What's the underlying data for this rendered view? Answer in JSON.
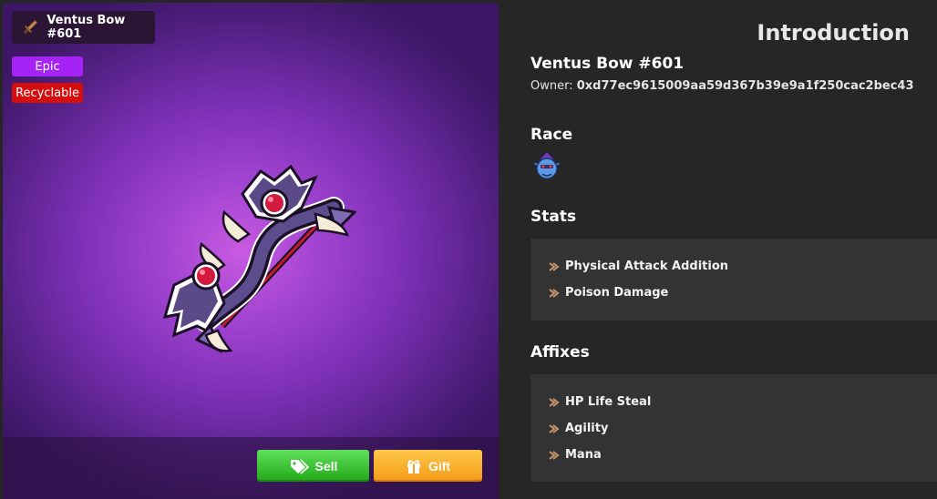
{
  "item": {
    "title": "Ventus Bow #601",
    "badges": {
      "rarity": "Epic",
      "recyclable": "Recyclable"
    }
  },
  "actions": {
    "sell_label": "Sell",
    "gift_label": "Gift"
  },
  "intro": {
    "heading": "Introduction",
    "name": "Ventus Bow #601",
    "owner_label": "Owner:",
    "owner_address": "0xd77ec9615009aa59d367b39e9a1f250cac2bec43"
  },
  "race": {
    "heading": "Race",
    "icon": "race-avatar-icon"
  },
  "stats": {
    "heading": "Stats",
    "items": [
      "Physical Attack Addition",
      "Poison Damage"
    ]
  },
  "affixes": {
    "heading": "Affixes",
    "items": [
      "HP Life Steal",
      "Agility",
      "Mana"
    ]
  },
  "colors": {
    "epic": "#a524f5",
    "recyclable": "#d40e0e",
    "sell": "#3cc92f",
    "gift": "#f7a928",
    "panel_bg": "#262626",
    "list_bg": "#333333"
  }
}
